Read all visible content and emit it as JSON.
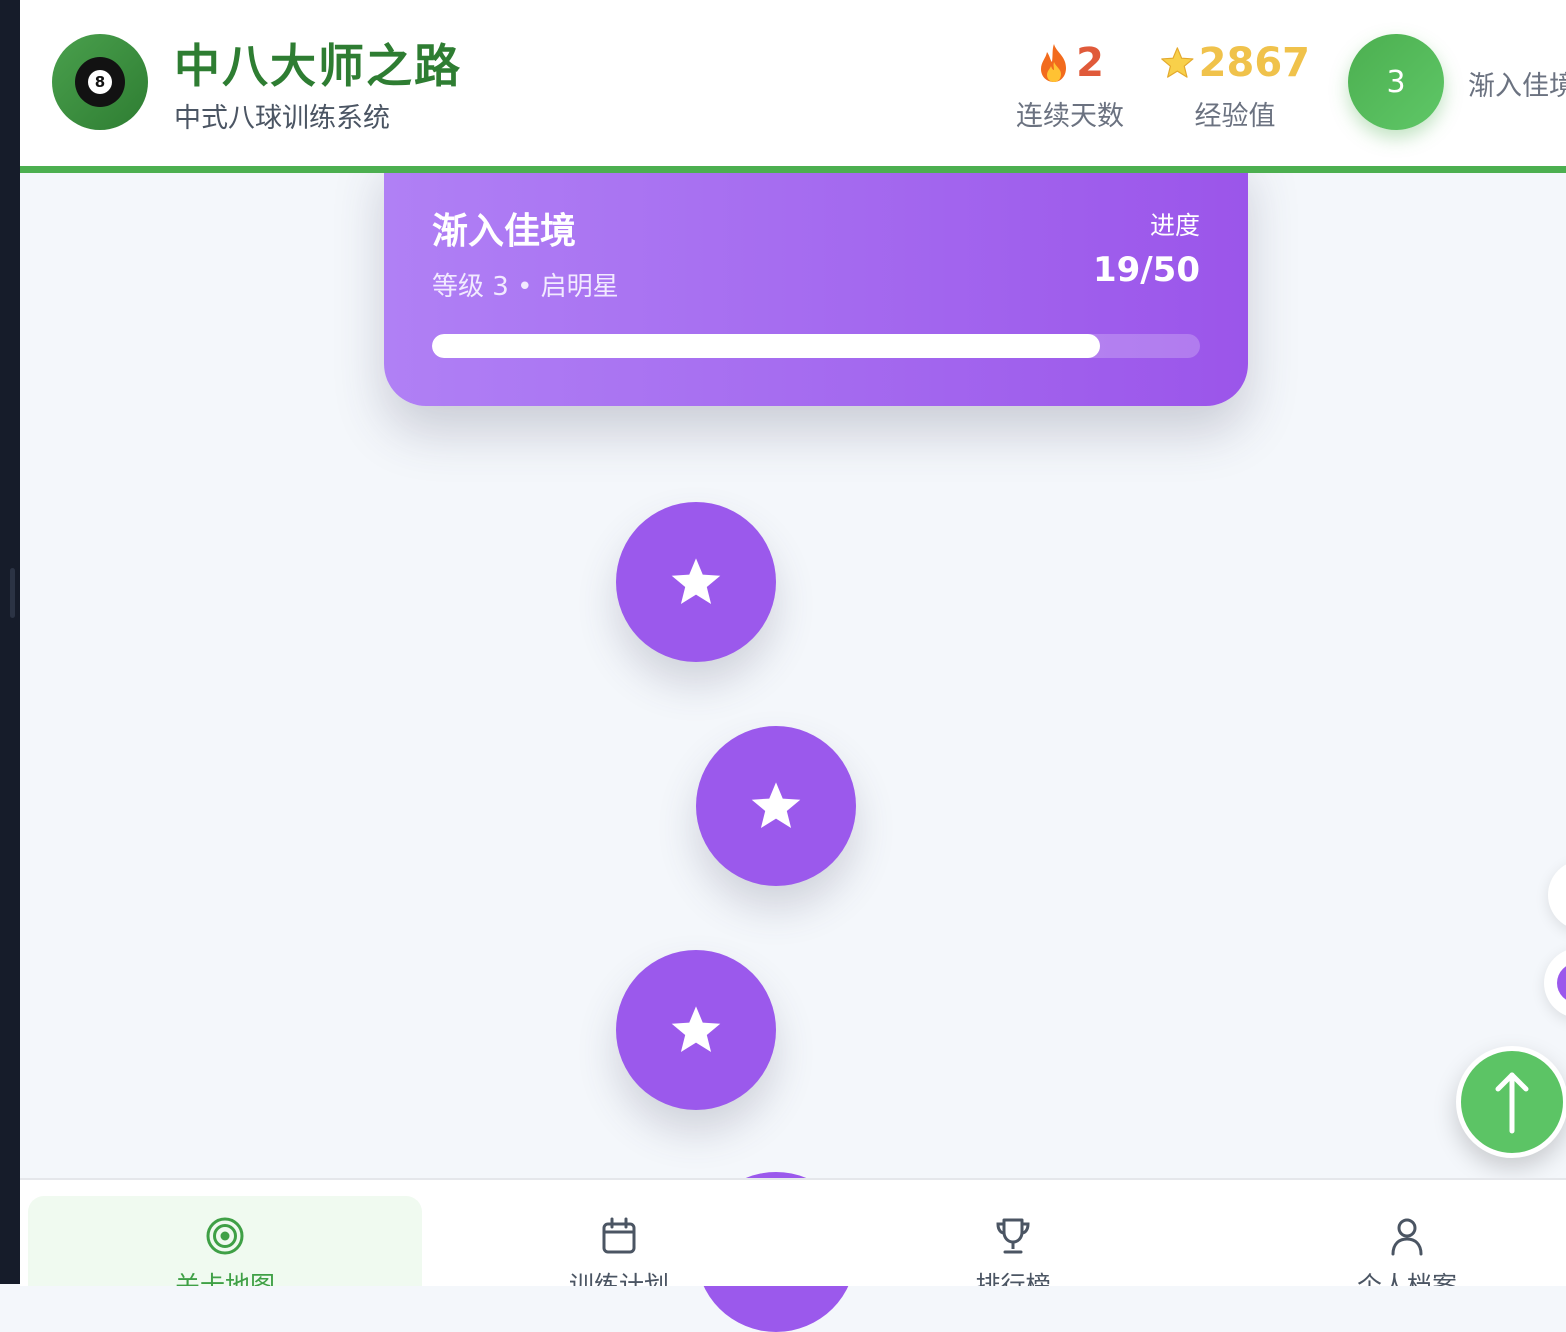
{
  "app": {
    "title": "中八大师之路",
    "subtitle": "中式八球训练系统",
    "ball_number": "8"
  },
  "stats": {
    "streak": {
      "icon": "fire-icon",
      "value": "2",
      "label": "连续天数"
    },
    "xp": {
      "icon": "star-icon",
      "value": "2867",
      "label": "经验值"
    }
  },
  "user": {
    "level": "3",
    "level_name": "渐入佳境"
  },
  "level_card": {
    "title": "渐入佳境",
    "subtitle": "等级 3 • 启明星",
    "progress_label": "进度",
    "progress_value": "19/50",
    "progress": {
      "current": 19,
      "total": 50,
      "fill_fraction": 0.87
    }
  },
  "map_nodes": [
    {
      "icon": "star-icon",
      "status": "completed"
    },
    {
      "icon": "star-icon",
      "status": "completed"
    },
    {
      "icon": "star-icon",
      "status": "completed"
    }
  ],
  "scroll_top_button": {
    "icon": "arrow-up-icon"
  },
  "bottom_nav": [
    {
      "label": "关卡地图",
      "icon": "target-icon",
      "active": true
    },
    {
      "label": "训练计划",
      "icon": "calendar-icon",
      "active": false
    },
    {
      "label": "排行榜",
      "icon": "trophy-icon",
      "active": false
    },
    {
      "label": "个人档案",
      "icon": "user-icon",
      "active": false
    }
  ],
  "colors": {
    "brand_green": "#2e7d32",
    "accent_green": "#4caf50",
    "purple": "#9b59ec",
    "streak_red": "#e05a3a",
    "xp_gold": "#f0c24b",
    "background": "#f4f7fb"
  }
}
